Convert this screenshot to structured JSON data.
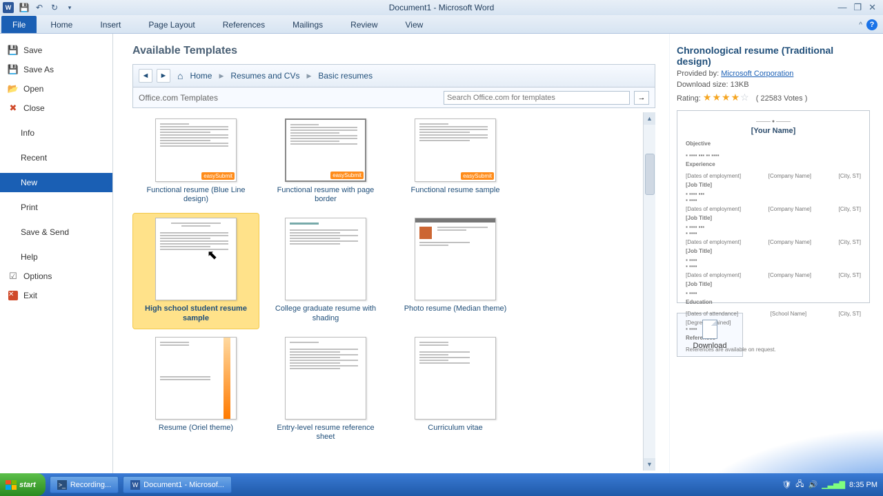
{
  "titlebar": {
    "title": "Document1 - Microsoft Word"
  },
  "ribbon": {
    "file": "File",
    "tabs": [
      "Home",
      "Insert",
      "Page Layout",
      "References",
      "Mailings",
      "Review",
      "View"
    ]
  },
  "backstage": {
    "items": [
      {
        "label": "Save",
        "icon": true
      },
      {
        "label": "Save As",
        "icon": true
      },
      {
        "label": "Open",
        "icon": true
      },
      {
        "label": "Close",
        "icon": true
      },
      {
        "label": "Info"
      },
      {
        "label": "Recent"
      },
      {
        "label": "New",
        "selected": true
      },
      {
        "label": "Print"
      },
      {
        "label": "Save & Send"
      },
      {
        "label": "Help"
      },
      {
        "label": "Options",
        "icon": true
      },
      {
        "label": "Exit",
        "icon": true
      }
    ]
  },
  "content": {
    "heading": "Available Templates",
    "breadcrumb": {
      "home": "Home",
      "l1": "Resumes and CVs",
      "l2": "Basic resumes"
    },
    "search_label": "Office.com Templates",
    "search_placeholder": "Search Office.com for templates",
    "templates": [
      "Functional resume (Blue Line design)",
      "Functional resume with page border",
      "Functional resume sample",
      "High school student resume sample",
      "College graduate resume with shading",
      "Photo resume (Median theme)",
      "Resume (Oriel theme)",
      "Entry-level resume reference sheet",
      "Curriculum vitae"
    ],
    "selected_index": 3
  },
  "details": {
    "title": "Chronological resume (Traditional design)",
    "provided_by_label": "Provided by:",
    "provided_by": "Microsoft Corporation",
    "download_size_label": "Download size:",
    "download_size": "13KB",
    "rating_label": "Rating:",
    "votes": "( 22583 Votes )",
    "preview_name": "[Your Name]",
    "download_button": "Download"
  },
  "taskbar": {
    "start": "start",
    "items": [
      "Recording...",
      "Document1 - Microsof..."
    ],
    "time": "8:35 PM"
  }
}
